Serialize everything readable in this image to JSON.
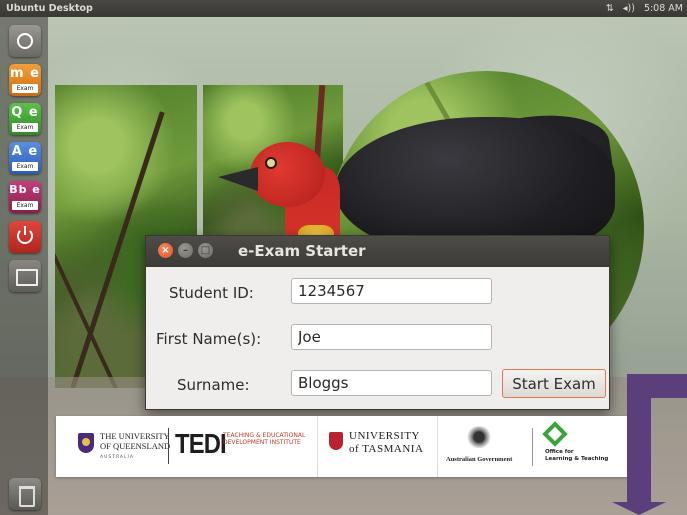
{
  "top_panel": {
    "title": "Ubuntu Desktop",
    "network_indicator": "⇅",
    "volume_indicator": "◂))",
    "clock": "5:08 AM"
  },
  "launcher": {
    "items": [
      {
        "name": "dash",
        "icon": "ubuntu-logo-icon"
      },
      {
        "name": "moodle-exam",
        "icon": "m-exam-icon",
        "letters": "m e",
        "caption": "Exam"
      },
      {
        "name": "quiz-exam",
        "icon": "q-exam-icon",
        "letters": "Q e",
        "caption": "Exam"
      },
      {
        "name": "access-exam",
        "icon": "a-exam-icon",
        "letters": "A e",
        "caption": "Exam"
      },
      {
        "name": "blackboard-exam",
        "icon": "bb-exam-icon",
        "letters": "Bb e",
        "caption": "Exam"
      },
      {
        "name": "shutdown",
        "icon": "power-icon"
      },
      {
        "name": "workspace-switcher",
        "icon": "workspace-icon"
      },
      {
        "name": "trash",
        "icon": "trash-icon"
      }
    ]
  },
  "dialog": {
    "title": "e-Exam Starter",
    "fields": {
      "student_id_label": "Student ID:",
      "student_id_value": "1234567",
      "first_name_label": "First Name(s):",
      "first_name_value": "Joe",
      "surname_label": "Surname:",
      "surname_value": "Bloggs"
    },
    "start_button": "Start Exam",
    "window_buttons": {
      "close": "×",
      "minimize": "–",
      "maximize": "□"
    }
  },
  "banner": {
    "uq_name": "THE UNIVERSITY\nOF QUEENSLAND",
    "uq_country": "AUSTRALIA",
    "tedi_mark": "TEDI",
    "tedi_full": "TEACHING & EDUCATIONAL\nDEVELOPMENT INSTITUTE",
    "utas_name": "UNIVERSITY\nof TASMANIA",
    "gov_name": "Australian Government",
    "olt_name": "Office for\nLearning & Teaching"
  },
  "colors": {
    "accent_orange": "#e0542a",
    "titlebar": "#3c3b37",
    "arrow_purple": "#5b3f7a"
  }
}
